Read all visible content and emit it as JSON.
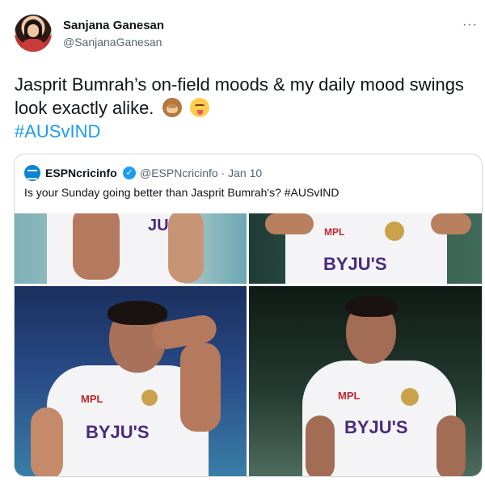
{
  "author": {
    "name": "Sanjana Ganesan",
    "handle": "@SanjanaGanesan"
  },
  "more_label": "···",
  "tweet": {
    "text_main": "Jasprit Bumrah’s on-field moods & my daily mood swings look exactly alike.",
    "hashtag": "#AUSvIND",
    "emoji_1": "see-no-evil-monkey",
    "emoji_2": "savoring-food-face"
  },
  "quoted": {
    "name": "ESPNcricinfo",
    "verified_glyph": "✓",
    "handle_date": "@ESPNcricinfo · Jan 10",
    "text": "Is your Sunday going better than Jasprit Bumrah's? #AUSvIND",
    "photo_brand": "BYJU'S",
    "photo_brand_2": "MPL"
  },
  "colors": {
    "link": "#1d9bf0",
    "text": "#0f1419",
    "muted": "#536471"
  }
}
